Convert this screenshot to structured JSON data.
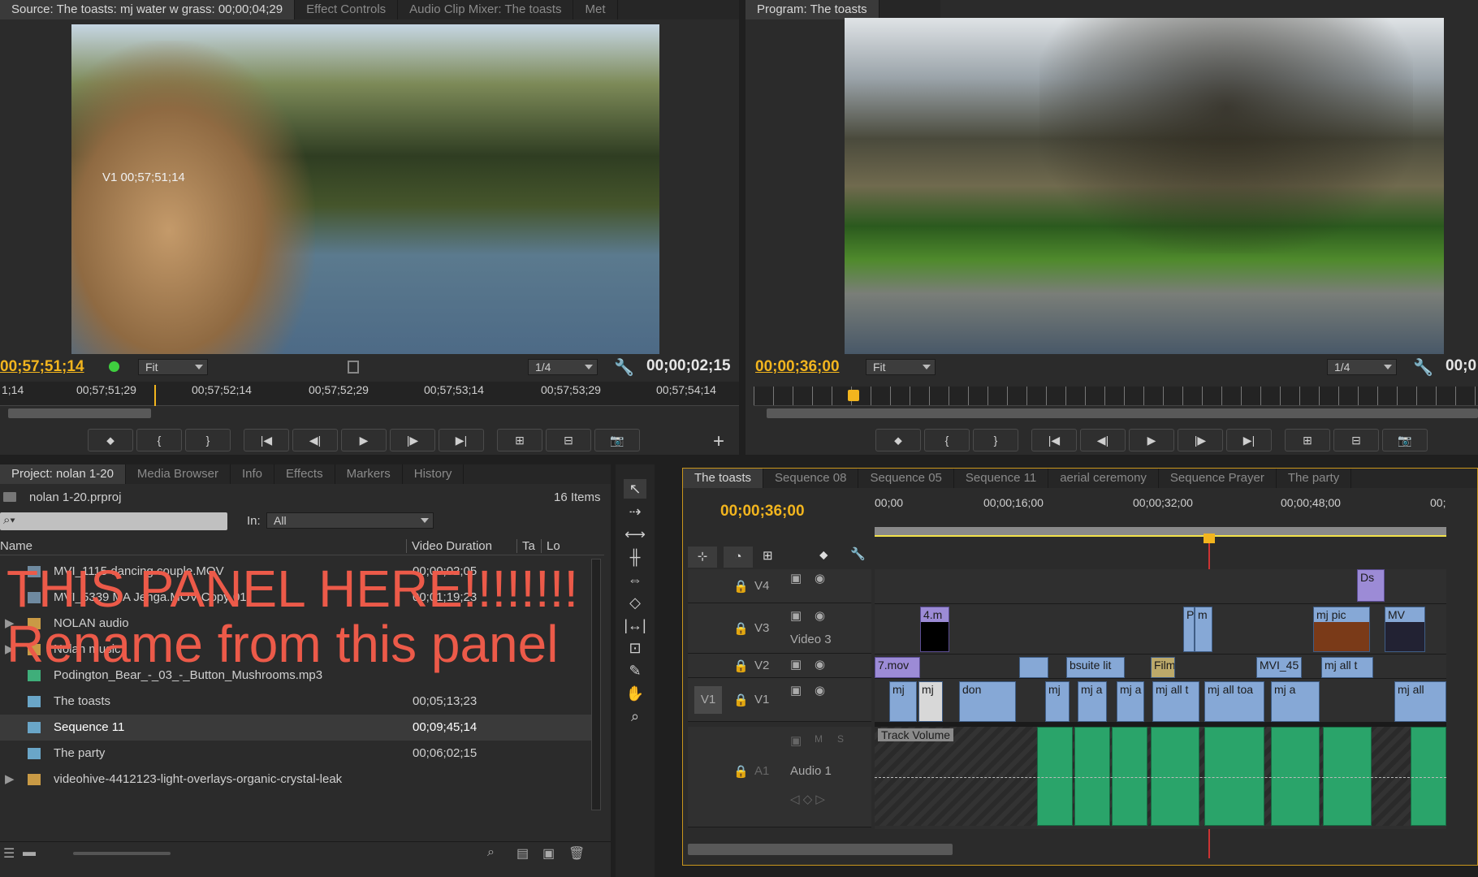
{
  "source_monitor": {
    "tabs": [
      "Source: The toasts: mj water w grass: 00;00;04;29",
      "Effect Controls",
      "Audio Clip Mixer: The toasts",
      "Met"
    ],
    "overlay_label": "V1 00;57;51;14",
    "timecode": "00;57;51;14",
    "zoom": "Fit",
    "resolution": "1/4",
    "duration": "00;00;02;15",
    "ruler_ticks": [
      "1;14",
      "00;57;51;29",
      "00;57;52;14",
      "00;57;52;29",
      "00;57;53;14",
      "00;57;53;29",
      "00;57;54;14"
    ]
  },
  "program_monitor": {
    "tab": "Program: The toasts",
    "timecode": "00;00;36;00",
    "zoom": "Fit",
    "resolution": "1/4",
    "duration": "00;0"
  },
  "transport": {
    "marker": "⬥",
    "in": "{",
    "out": "}",
    "go_in": "|◀",
    "step_back": "◀|",
    "play": "▶",
    "step_fwd": "|▶",
    "go_out": "▶|",
    "insert": "⊞",
    "overwrite": "⊟",
    "export": "📷",
    "add": "+"
  },
  "project": {
    "tabs": [
      "Project: nolan 1-20",
      "Media Browser",
      "Info",
      "Effects",
      "Markers",
      "History"
    ],
    "file": "nolan 1-20.prproj",
    "count": "16 Items",
    "in_label": "In:",
    "in_value": "All",
    "col_name": "Name",
    "col_duration": "Video Duration",
    "col_ta": "Ta",
    "col_lo": "Lo",
    "items": [
      {
        "name": "MVI_1115 dancing couple.MOV",
        "duration": "00;00;02;05",
        "kind": "video"
      },
      {
        "name": "MVI_5339 MA Jenga.MOV Copy 01",
        "duration": "00;01;19;23",
        "kind": "video"
      },
      {
        "name": "NOLAN audio",
        "duration": "",
        "kind": "folder"
      },
      {
        "name": "Nolan music",
        "duration": "",
        "kind": "folder"
      },
      {
        "name": "Podington_Bear_-_03_-_Button_Mushrooms.mp3",
        "duration": "",
        "kind": "audio"
      },
      {
        "name": "The toasts",
        "duration": "00;05;13;23",
        "kind": "seq"
      },
      {
        "name": "Sequence 11",
        "duration": "00;09;45;14",
        "kind": "seq"
      },
      {
        "name": "The party",
        "duration": "00;06;02;15",
        "kind": "seq"
      },
      {
        "name": "videohive-4412123-light-overlays-organic-crystal-leak",
        "duration": "",
        "kind": "folder"
      }
    ]
  },
  "annotation": {
    "line1": "THIS PANEL HERE!!!!!!!!",
    "line2": "Rename from this panel"
  },
  "timeline": {
    "tabs": [
      "The toasts",
      "Sequence 08",
      "Sequence 05",
      "Sequence 11",
      "aerial ceremony",
      "Sequence Prayer",
      "The party"
    ],
    "timecode": "00;00;36;00",
    "ruler": [
      "00;00",
      "00;00;16;00",
      "00;00;32;00",
      "00;00;48;00",
      "00;"
    ],
    "tracks": {
      "v4": "V4",
      "v3": "V3",
      "v3_name": "Video 3",
      "v2": "V2",
      "v1": "V1",
      "v1_src": "V1",
      "a1": "A1",
      "a1_name": "Audio 1",
      "m": "M",
      "s": "S",
      "track_volume": "Track Volume"
    },
    "clips": {
      "c1": "4.m",
      "c2": "P",
      "c3": "m",
      "c4": "mj pic",
      "c5": "MV",
      "c6": "7.mov",
      "c7": "bsuite lit",
      "c8": "Film",
      "c9": "MVI_45",
      "c10": "mj all t",
      "c11": "mj",
      "c12": "mj",
      "c13": "don",
      "c14": "mj",
      "c15": "mj a",
      "c16": "mj a",
      "c17": "mj all t",
      "c18": "mj all toa",
      "c19": "mj a",
      "c20": "mj all",
      "c21": "Ds"
    }
  }
}
